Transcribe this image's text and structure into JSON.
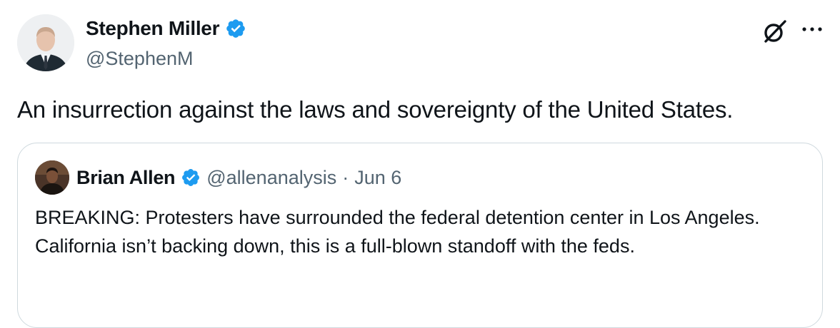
{
  "tweet": {
    "author": {
      "display_name": "Stephen Miller",
      "handle": "@StephenM",
      "verified": true,
      "avatar_icon": "avatar-photo"
    },
    "text": "An insurrection against the laws and sovereignty of the United States.",
    "actions": {
      "grok_icon": "grok-icon",
      "more_icon": "more-icon"
    }
  },
  "quoted_tweet": {
    "author": {
      "display_name": "Brian Allen",
      "handle": "@allenanalysis",
      "verified": true,
      "avatar_icon": "avatar-photo"
    },
    "separator": "·",
    "date": "Jun 6",
    "text": "BREAKING: Protesters have surrounded the federal detention center in Los Angeles. California isn’t backing down, this is a full-blown standoff with the feds."
  },
  "colors": {
    "text_primary": "#0f1419",
    "text_secondary": "#536471",
    "verified_blue": "#1d9bf0",
    "border": "#cfd9de"
  }
}
